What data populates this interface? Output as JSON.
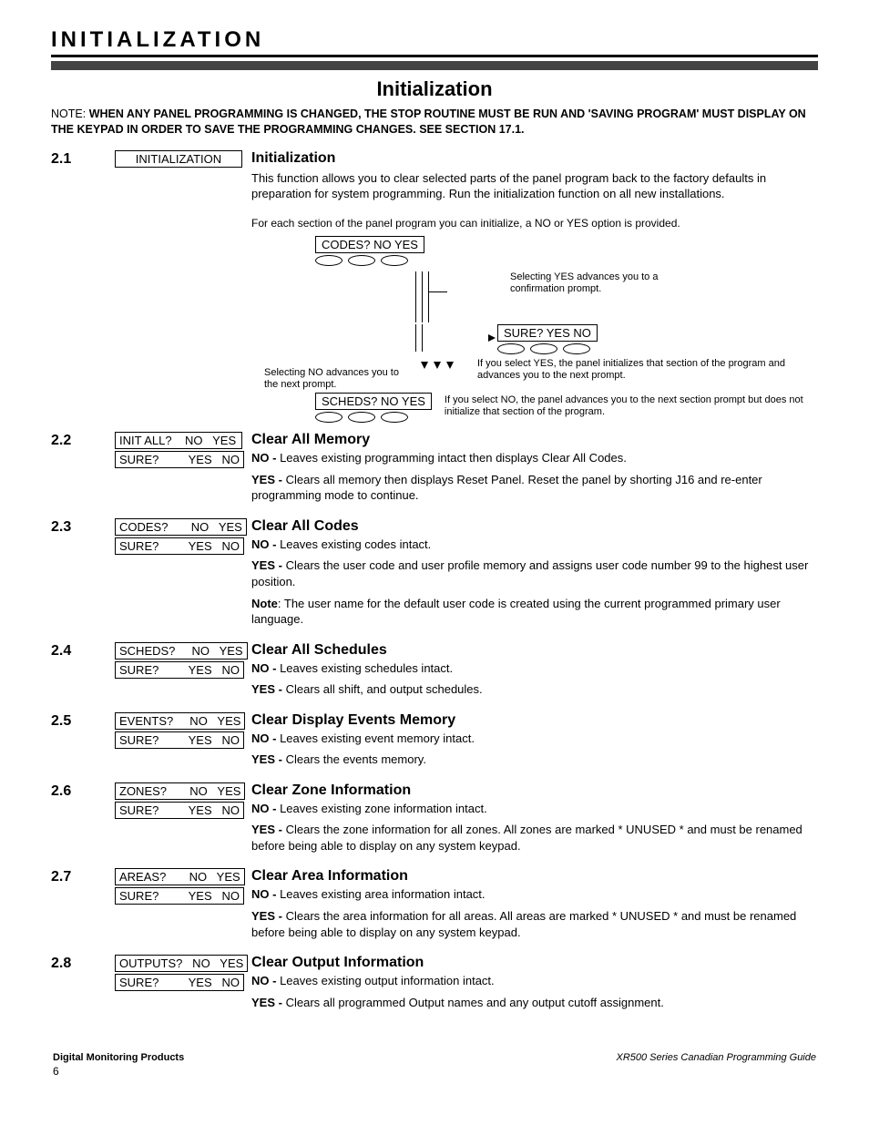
{
  "header": {
    "chapter": "INITIALIZATION",
    "main_title": "Initialization"
  },
  "note": {
    "prefix": "NOTE:",
    "body": "WHEN ANY PANEL PROGRAMMING IS CHANGED, THE STOP ROUTINE MUST BE RUN AND 'SAVING PROGRAM' MUST DISPLAY ON THE KEYPAD IN ORDER TO SAVE THE PROGRAMMING CHANGES.  SEE SECTION 17.1."
  },
  "diagram": {
    "intro": "For each section of the panel program you can initialize, a NO or YES option is provided.",
    "codes": "CODES?        NO    YES",
    "sure": "SURE?         YES    NO",
    "scheds": "SCHEDS?      NO    YES",
    "side_yes": "Selecting YES advances you to a confirmation prompt.",
    "side_no": "Selecting NO advances you to the next prompt.",
    "conf_yes": "If you select YES, the panel initializes that section of the program and advances you to the next prompt.",
    "conf_no": "If you select NO, the panel advances you to the next section prompt but does not initialize that section of the program."
  },
  "sections": [
    {
      "num": "2.1",
      "keypad": [
        "INITIALIZATION"
      ],
      "heading": "Initialization",
      "paras": [
        "This function allows you to clear selected parts of the panel program back to the factory defaults in preparation for system programming.  Run the initialization function on all new installations."
      ]
    },
    {
      "num": "2.2",
      "keypad": [
        "INIT ALL?    NO   YES",
        "SURE?         YES   NO"
      ],
      "heading": "Clear All Memory",
      "lines": [
        {
          "label": "NO - ",
          "text": "Leaves existing programming intact then displays Clear All Codes."
        },
        {
          "label": "YES - ",
          "text": "Clears all memory then displays Reset Panel.  Reset the panel by shorting J16 and re-enter programming mode to continue."
        }
      ]
    },
    {
      "num": "2.3",
      "keypad": [
        "CODES?       NO   YES",
        "SURE?         YES   NO"
      ],
      "heading": "Clear All Codes",
      "lines": [
        {
          "label": "NO - ",
          "text": "Leaves existing codes intact."
        },
        {
          "label": "YES - ",
          "text": "Clears the user code and user profile memory and assigns user code number 99 to the highest user position."
        },
        {
          "label": "Note",
          "text": ":  The user name for the default user code is created using the current programmed primary user language."
        }
      ]
    },
    {
      "num": "2.4",
      "keypad": [
        "SCHEDS?     NO   YES",
        "SURE?         YES   NO"
      ],
      "heading": "Clear All Schedules",
      "lines": [
        {
          "label": "NO - ",
          "text": "Leaves existing schedules intact."
        },
        {
          "label": "YES - ",
          "text": "Clears all shift, and output schedules."
        }
      ]
    },
    {
      "num": "2.5",
      "keypad": [
        "EVENTS?     NO   YES",
        "SURE?         YES   NO"
      ],
      "heading": "Clear Display Events Memory",
      "lines": [
        {
          "label": "NO - ",
          "text": "Leaves existing event memory intact."
        },
        {
          "label": "YES - ",
          "text": "Clears the events memory."
        }
      ]
    },
    {
      "num": "2.6",
      "keypad": [
        "ZONES?       NO   YES",
        "SURE?         YES   NO"
      ],
      "heading": "Clear Zone Information",
      "lines": [
        {
          "label": "NO - ",
          "text": "Leaves existing zone information intact."
        },
        {
          "label": "YES - ",
          "text": "Clears the zone information for all zones.  All zones are marked * UNUSED * and must be renamed before being able to display on any system keypad."
        }
      ]
    },
    {
      "num": "2.7",
      "keypad": [
        "AREAS?       NO   YES",
        "SURE?         YES   NO"
      ],
      "heading": "Clear Area Information",
      "lines": [
        {
          "label": "NO - ",
          "text": "Leaves existing area information intact."
        },
        {
          "label": "YES - ",
          "text": "Clears the area information for all areas.  All areas are marked * UNUSED * and must be renamed before being able to display on any system keypad."
        }
      ]
    },
    {
      "num": "2.8",
      "keypad": [
        "OUTPUTS?   NO   YES",
        "SURE?         YES   NO"
      ],
      "heading": "Clear Output Information",
      "lines": [
        {
          "label": "NO - ",
          "text": "Leaves existing output information intact."
        },
        {
          "label": "YES - ",
          "text": "Clears all programmed Output names and any output cutoff assignment."
        }
      ]
    }
  ],
  "footer": {
    "left": "Digital Monitoring Products",
    "right": "XR500 Series Canadian Programming Guide",
    "page": "6"
  }
}
